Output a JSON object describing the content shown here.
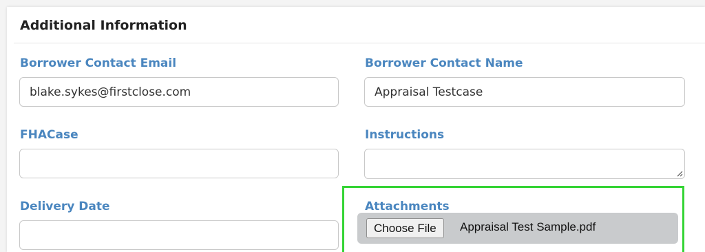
{
  "section": {
    "title": "Additional Information"
  },
  "fields": {
    "borrower_contact_email": {
      "label": "Borrower Contact Email",
      "value": "blake.sykes@firstclose.com"
    },
    "borrower_contact_name": {
      "label": "Borrower Contact Name",
      "value": "Appraisal Testcase"
    },
    "fha_case": {
      "label": "FHACase",
      "value": ""
    },
    "instructions": {
      "label": "Instructions",
      "value": ""
    },
    "delivery_date": {
      "label": "Delivery Date",
      "value": ""
    },
    "attachments": {
      "label": "Attachments",
      "button_label": "Choose File",
      "file_name": "Appraisal Test Sample.pdf"
    }
  },
  "colors": {
    "label": "#4a86bf",
    "highlight": "#35d435"
  }
}
